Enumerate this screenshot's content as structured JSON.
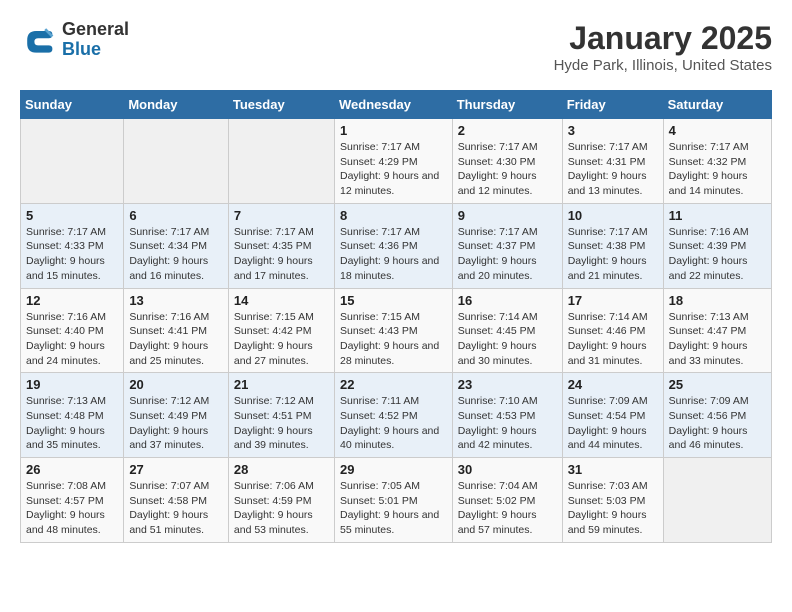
{
  "logo": {
    "general": "General",
    "blue": "Blue"
  },
  "title": "January 2025",
  "subtitle": "Hyde Park, Illinois, United States",
  "weekdays": [
    "Sunday",
    "Monday",
    "Tuesday",
    "Wednesday",
    "Thursday",
    "Friday",
    "Saturday"
  ],
  "weeks": [
    [
      {
        "day": "",
        "sunrise": "",
        "sunset": "",
        "daylight": ""
      },
      {
        "day": "",
        "sunrise": "",
        "sunset": "",
        "daylight": ""
      },
      {
        "day": "",
        "sunrise": "",
        "sunset": "",
        "daylight": ""
      },
      {
        "day": "1",
        "sunrise": "Sunrise: 7:17 AM",
        "sunset": "Sunset: 4:29 PM",
        "daylight": "Daylight: 9 hours and 12 minutes."
      },
      {
        "day": "2",
        "sunrise": "Sunrise: 7:17 AM",
        "sunset": "Sunset: 4:30 PM",
        "daylight": "Daylight: 9 hours and 12 minutes."
      },
      {
        "day": "3",
        "sunrise": "Sunrise: 7:17 AM",
        "sunset": "Sunset: 4:31 PM",
        "daylight": "Daylight: 9 hours and 13 minutes."
      },
      {
        "day": "4",
        "sunrise": "Sunrise: 7:17 AM",
        "sunset": "Sunset: 4:32 PM",
        "daylight": "Daylight: 9 hours and 14 minutes."
      }
    ],
    [
      {
        "day": "5",
        "sunrise": "Sunrise: 7:17 AM",
        "sunset": "Sunset: 4:33 PM",
        "daylight": "Daylight: 9 hours and 15 minutes."
      },
      {
        "day": "6",
        "sunrise": "Sunrise: 7:17 AM",
        "sunset": "Sunset: 4:34 PM",
        "daylight": "Daylight: 9 hours and 16 minutes."
      },
      {
        "day": "7",
        "sunrise": "Sunrise: 7:17 AM",
        "sunset": "Sunset: 4:35 PM",
        "daylight": "Daylight: 9 hours and 17 minutes."
      },
      {
        "day": "8",
        "sunrise": "Sunrise: 7:17 AM",
        "sunset": "Sunset: 4:36 PM",
        "daylight": "Daylight: 9 hours and 18 minutes."
      },
      {
        "day": "9",
        "sunrise": "Sunrise: 7:17 AM",
        "sunset": "Sunset: 4:37 PM",
        "daylight": "Daylight: 9 hours and 20 minutes."
      },
      {
        "day": "10",
        "sunrise": "Sunrise: 7:17 AM",
        "sunset": "Sunset: 4:38 PM",
        "daylight": "Daylight: 9 hours and 21 minutes."
      },
      {
        "day": "11",
        "sunrise": "Sunrise: 7:16 AM",
        "sunset": "Sunset: 4:39 PM",
        "daylight": "Daylight: 9 hours and 22 minutes."
      }
    ],
    [
      {
        "day": "12",
        "sunrise": "Sunrise: 7:16 AM",
        "sunset": "Sunset: 4:40 PM",
        "daylight": "Daylight: 9 hours and 24 minutes."
      },
      {
        "day": "13",
        "sunrise": "Sunrise: 7:16 AM",
        "sunset": "Sunset: 4:41 PM",
        "daylight": "Daylight: 9 hours and 25 minutes."
      },
      {
        "day": "14",
        "sunrise": "Sunrise: 7:15 AM",
        "sunset": "Sunset: 4:42 PM",
        "daylight": "Daylight: 9 hours and 27 minutes."
      },
      {
        "day": "15",
        "sunrise": "Sunrise: 7:15 AM",
        "sunset": "Sunset: 4:43 PM",
        "daylight": "Daylight: 9 hours and 28 minutes."
      },
      {
        "day": "16",
        "sunrise": "Sunrise: 7:14 AM",
        "sunset": "Sunset: 4:45 PM",
        "daylight": "Daylight: 9 hours and 30 minutes."
      },
      {
        "day": "17",
        "sunrise": "Sunrise: 7:14 AM",
        "sunset": "Sunset: 4:46 PM",
        "daylight": "Daylight: 9 hours and 31 minutes."
      },
      {
        "day": "18",
        "sunrise": "Sunrise: 7:13 AM",
        "sunset": "Sunset: 4:47 PM",
        "daylight": "Daylight: 9 hours and 33 minutes."
      }
    ],
    [
      {
        "day": "19",
        "sunrise": "Sunrise: 7:13 AM",
        "sunset": "Sunset: 4:48 PM",
        "daylight": "Daylight: 9 hours and 35 minutes."
      },
      {
        "day": "20",
        "sunrise": "Sunrise: 7:12 AM",
        "sunset": "Sunset: 4:49 PM",
        "daylight": "Daylight: 9 hours and 37 minutes."
      },
      {
        "day": "21",
        "sunrise": "Sunrise: 7:12 AM",
        "sunset": "Sunset: 4:51 PM",
        "daylight": "Daylight: 9 hours and 39 minutes."
      },
      {
        "day": "22",
        "sunrise": "Sunrise: 7:11 AM",
        "sunset": "Sunset: 4:52 PM",
        "daylight": "Daylight: 9 hours and 40 minutes."
      },
      {
        "day": "23",
        "sunrise": "Sunrise: 7:10 AM",
        "sunset": "Sunset: 4:53 PM",
        "daylight": "Daylight: 9 hours and 42 minutes."
      },
      {
        "day": "24",
        "sunrise": "Sunrise: 7:09 AM",
        "sunset": "Sunset: 4:54 PM",
        "daylight": "Daylight: 9 hours and 44 minutes."
      },
      {
        "day": "25",
        "sunrise": "Sunrise: 7:09 AM",
        "sunset": "Sunset: 4:56 PM",
        "daylight": "Daylight: 9 hours and 46 minutes."
      }
    ],
    [
      {
        "day": "26",
        "sunrise": "Sunrise: 7:08 AM",
        "sunset": "Sunset: 4:57 PM",
        "daylight": "Daylight: 9 hours and 48 minutes."
      },
      {
        "day": "27",
        "sunrise": "Sunrise: 7:07 AM",
        "sunset": "Sunset: 4:58 PM",
        "daylight": "Daylight: 9 hours and 51 minutes."
      },
      {
        "day": "28",
        "sunrise": "Sunrise: 7:06 AM",
        "sunset": "Sunset: 4:59 PM",
        "daylight": "Daylight: 9 hours and 53 minutes."
      },
      {
        "day": "29",
        "sunrise": "Sunrise: 7:05 AM",
        "sunset": "Sunset: 5:01 PM",
        "daylight": "Daylight: 9 hours and 55 minutes."
      },
      {
        "day": "30",
        "sunrise": "Sunrise: 7:04 AM",
        "sunset": "Sunset: 5:02 PM",
        "daylight": "Daylight: 9 hours and 57 minutes."
      },
      {
        "day": "31",
        "sunrise": "Sunrise: 7:03 AM",
        "sunset": "Sunset: 5:03 PM",
        "daylight": "Daylight: 9 hours and 59 minutes."
      },
      {
        "day": "",
        "sunrise": "",
        "sunset": "",
        "daylight": ""
      }
    ]
  ]
}
